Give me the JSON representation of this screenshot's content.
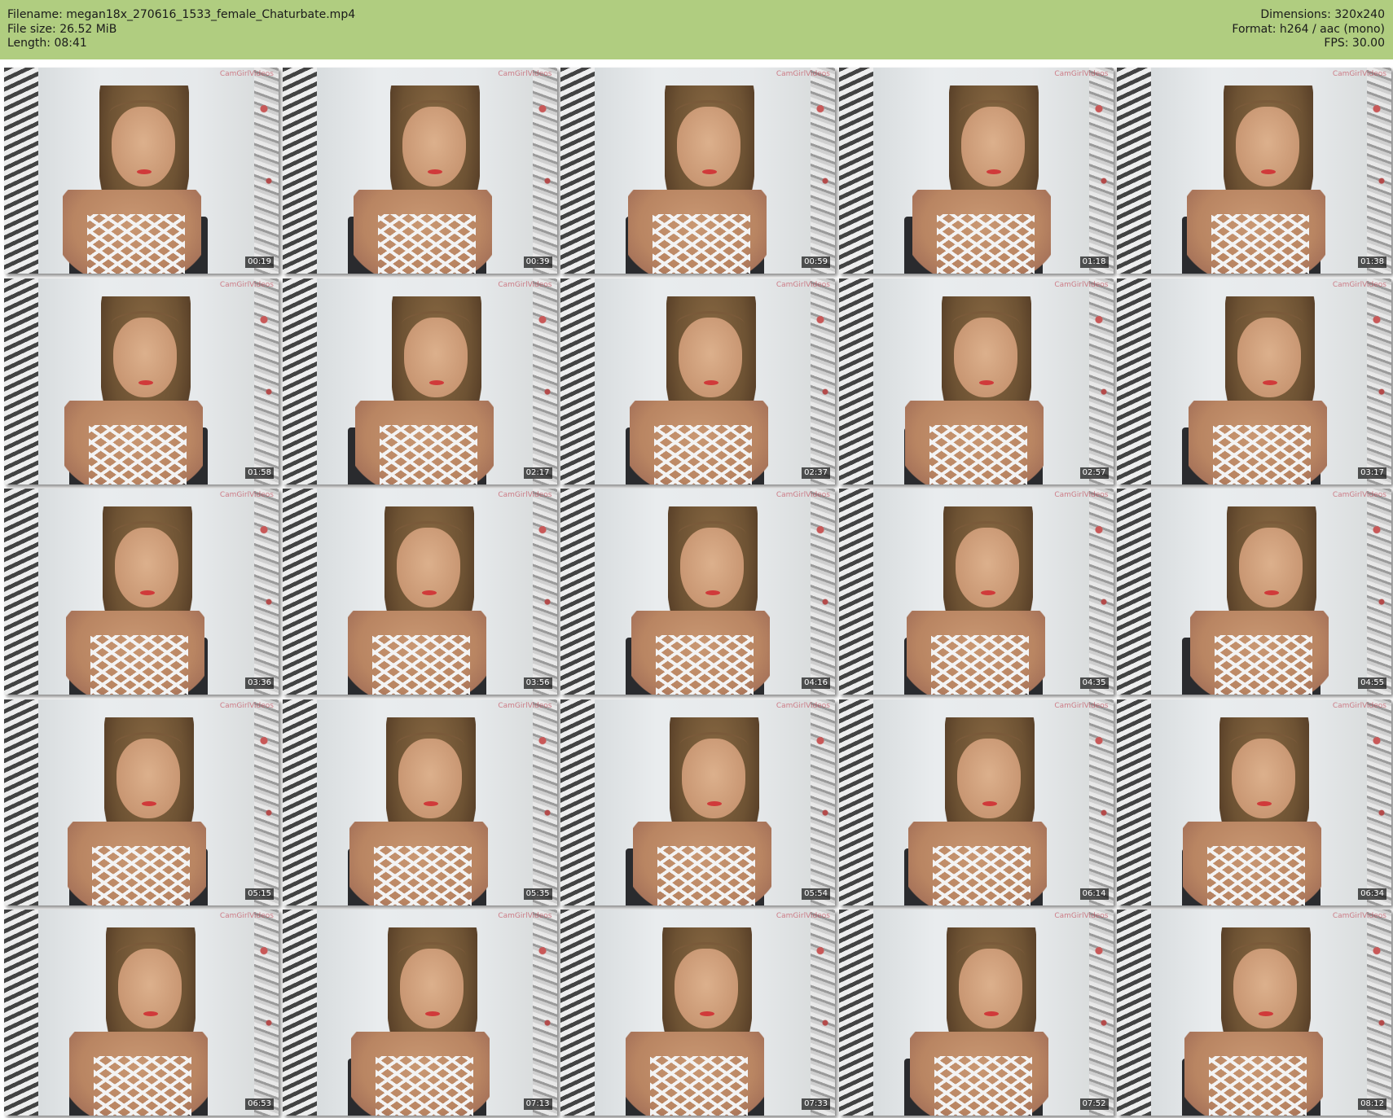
{
  "header": {
    "filename": "Filename: megan18x_270616_1533_female_Chaturbate.mp4",
    "filesize": "File size: 26.52 MiB",
    "length": "Length: 08:41",
    "dimensions": "Dimensions: 320x240",
    "format": "Format: h264 / aac (mono)",
    "fps": "FPS: 30.00"
  },
  "watermark": "CamGirlVideos",
  "thumbnails": [
    {
      "timestamp": "00:19"
    },
    {
      "timestamp": "00:39"
    },
    {
      "timestamp": "00:59"
    },
    {
      "timestamp": "01:18"
    },
    {
      "timestamp": "01:38"
    },
    {
      "timestamp": "01:58"
    },
    {
      "timestamp": "02:17"
    },
    {
      "timestamp": "02:37"
    },
    {
      "timestamp": "02:57"
    },
    {
      "timestamp": "03:17"
    },
    {
      "timestamp": "03:36"
    },
    {
      "timestamp": "03:56"
    },
    {
      "timestamp": "04:16"
    },
    {
      "timestamp": "04:35"
    },
    {
      "timestamp": "04:55"
    },
    {
      "timestamp": "05:15"
    },
    {
      "timestamp": "05:35"
    },
    {
      "timestamp": "05:54"
    },
    {
      "timestamp": "06:14"
    },
    {
      "timestamp": "06:34"
    },
    {
      "timestamp": "06:53"
    },
    {
      "timestamp": "07:13"
    },
    {
      "timestamp": "07:33"
    },
    {
      "timestamp": "07:52"
    },
    {
      "timestamp": "08:12"
    }
  ]
}
